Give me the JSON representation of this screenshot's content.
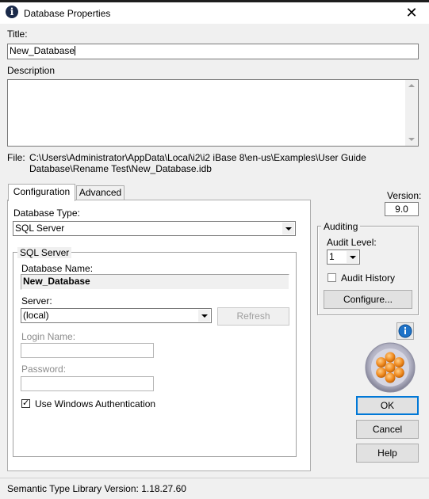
{
  "window": {
    "title": "Database Properties",
    "close_glyph": "✕",
    "app_icon_glyph": "i"
  },
  "title_label": "Title:",
  "title_value": "New_Database",
  "description_label": "Description",
  "description_value": "",
  "file": {
    "label": "File:",
    "path_line1": "C:\\Users\\Administrator\\AppData\\Local\\i2\\i2 iBase 8\\en-us\\Examples\\User Guide",
    "path_line2": "Database\\Rename Test\\New_Database.idb"
  },
  "tabs": [
    {
      "label": "Configuration",
      "active": true
    },
    {
      "label": "Advanced",
      "active": false
    }
  ],
  "config": {
    "db_type_label": "Database Type:",
    "db_type_value": "SQL Server",
    "sql_group_title": "SQL Server",
    "db_name_label": "Database Name:",
    "db_name_value": "New_Database",
    "server_label": "Server:",
    "server_value": "(local)",
    "refresh_label": "Refresh",
    "login_label": "Login Name:",
    "login_value": "",
    "password_label": "Password:",
    "password_value": "",
    "windows_auth_label": "Use Windows Authentication",
    "windows_auth_checked": true
  },
  "version": {
    "label": "Version:",
    "value": "9.0"
  },
  "auditing": {
    "group_title": "Auditing",
    "level_label": "Audit Level:",
    "level_value": "1",
    "history_label": "Audit History",
    "history_checked": false,
    "configure_label": "Configure..."
  },
  "buttons": {
    "ok": "OK",
    "cancel": "Cancel",
    "help": "Help"
  },
  "status_bar": "Semantic Type Library Version: 1.18.27.60",
  "icons": {
    "info": "info-icon",
    "logo": "ibase-logo-icon",
    "check": "✓"
  },
  "colors": {
    "accent": "#0078d7",
    "logo_orange": "#f08a1e",
    "logo_ring": "#b3b3c4",
    "info_blue": "#1e73c8"
  }
}
